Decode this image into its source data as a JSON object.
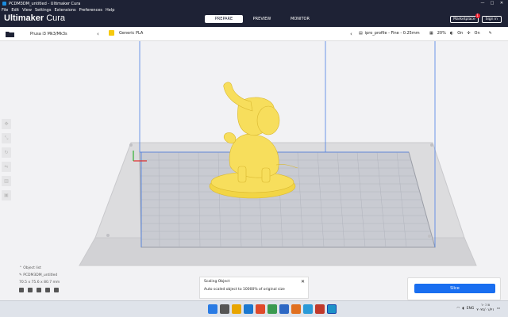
{
  "window": {
    "title": "PCDM3DM_untitled - Ultimaker Cura",
    "controls": [
      "—",
      "□",
      "✕"
    ]
  },
  "menu": [
    "File",
    "Edit",
    "View",
    "Settings",
    "Extensions",
    "Preferences",
    "Help"
  ],
  "header": {
    "logo_main": "Ultimaker",
    "logo_sub": " Cura",
    "tabs": [
      {
        "label": "PREPARE",
        "active": true
      },
      {
        "label": "PREVIEW",
        "active": false
      },
      {
        "label": "MONITOR",
        "active": false
      }
    ],
    "marketplace": "Marketplace",
    "marketplace_badge": "1",
    "signin": "Sign in"
  },
  "toolbar": {
    "printer": "Prusa i3 Mk3/Mk3s",
    "material": "Generic PLA",
    "profile": "ipro_profile - Fine - 0.25mm",
    "infill": "20%",
    "support": "On",
    "adhesion": "On"
  },
  "object": {
    "list_label": "Object list",
    "filename": "PCDM3DM_untitled",
    "dimensions": "70.5 x 75.6 x 80.7 mm"
  },
  "message": {
    "title": "Scaling Object",
    "body": "Auto scaled object to 10000% of original size"
  },
  "slice": {
    "label": "Slice"
  },
  "taskbar": {
    "lang": "ENG",
    "time": "١٠:١٨",
    "date": "٢٠٢٤/٠١/٢١"
  },
  "colors": {
    "header_bg": "#1e2235",
    "accent": "#196ef0",
    "model": "#f7de5c"
  }
}
